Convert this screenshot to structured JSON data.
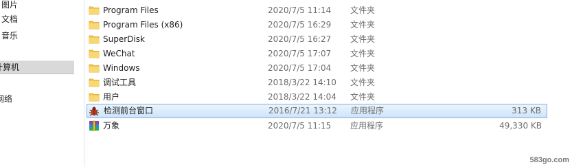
{
  "nav": {
    "items": [
      {
        "label": "图片",
        "icon": "pictures-library-icon"
      },
      {
        "label": "文档",
        "icon": "documents-library-icon"
      },
      {
        "label": "音乐",
        "icon": "music-library-icon"
      },
      {
        "label": "计算机",
        "icon": "computer-icon",
        "selected": true
      },
      {
        "label": "网络",
        "icon": "network-icon"
      }
    ]
  },
  "files": [
    {
      "name": "Program Files",
      "date": "2020/7/5 11:14",
      "type": "文件夹",
      "size": "",
      "icon": "folder-icon"
    },
    {
      "name": "Program Files (x86)",
      "date": "2020/7/5 16:29",
      "type": "文件夹",
      "size": "",
      "icon": "folder-icon"
    },
    {
      "name": "SuperDisk",
      "date": "2020/7/5 16:27",
      "type": "文件夹",
      "size": "",
      "icon": "folder-icon"
    },
    {
      "name": "WeChat",
      "date": "2020/7/5 17:07",
      "type": "文件夹",
      "size": "",
      "icon": "folder-icon"
    },
    {
      "name": "Windows",
      "date": "2020/7/5 17:04",
      "type": "文件夹",
      "size": "",
      "icon": "folder-icon"
    },
    {
      "name": "调试工具",
      "date": "2018/3/22 14:10",
      "type": "文件夹",
      "size": "",
      "icon": "folder-icon"
    },
    {
      "name": "用户",
      "date": "2018/3/22 14:04",
      "type": "文件夹",
      "size": "",
      "icon": "folder-icon"
    },
    {
      "name": "检测前台窗口",
      "date": "2016/7/21 13:12",
      "type": "应用程序",
      "size": "313 KB",
      "icon": "bug-app-icon",
      "selected": true
    },
    {
      "name": "万象",
      "date": "2020/7/5 11:15",
      "type": "应用程序",
      "size": "49,330 KB",
      "icon": "rar-archive-icon"
    }
  ],
  "watermark": "583go.com",
  "colors": {
    "selection_border": "#84acdd",
    "selection_fill": "#cfe4fa",
    "folder_yellow": "#f2c94c"
  }
}
